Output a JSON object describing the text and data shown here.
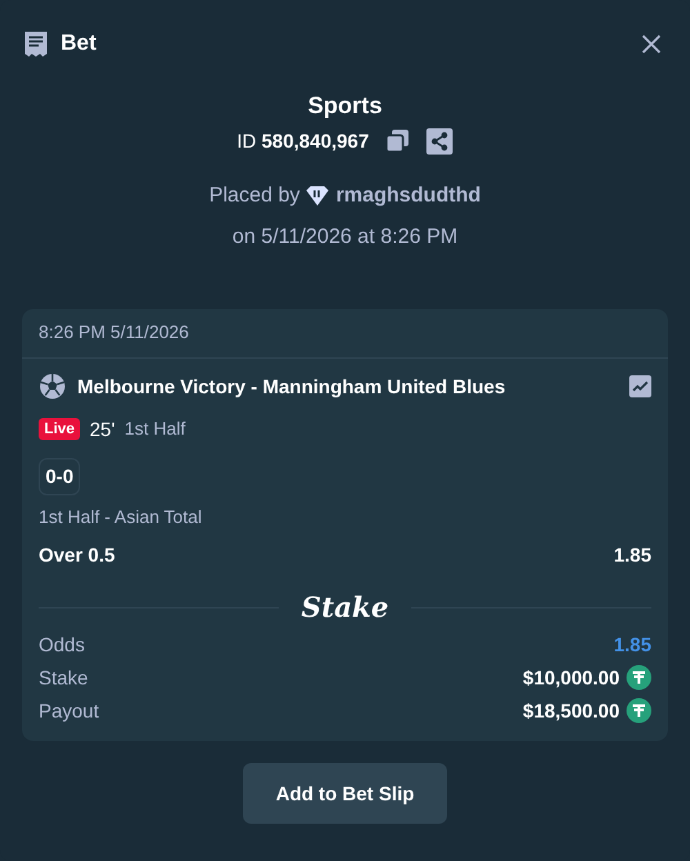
{
  "modal": {
    "title": "Bet"
  },
  "bet": {
    "category": "Sports",
    "id": "ID **580,840,967**",
    "placed_by_label": "Placed by",
    "username": "rmaghsdudthd",
    "placed_on": "on 5/11/2026 at 8:26 PM"
  },
  "card": {
    "timestamp": "8:26 PM 5/11/2026",
    "event": "Melbourne Victory - Manningham United Blues",
    "live": true,
    "live_label": "Live",
    "minute": "25'",
    "period": "1st Half",
    "score": "0-0",
    "market": "1st Half - Asian Total",
    "selection": "Over 0.5",
    "selection_odds": "1.85",
    "brand": "Stake",
    "summary": [
      {
        "label": "Odds",
        "value": "1.85",
        "kind": "odds"
      },
      {
        "label": "Stake",
        "value": "$10,000.00",
        "kind": "amount"
      },
      {
        "label": "Payout",
        "value": "$18,500.00",
        "kind": "amount"
      }
    ]
  },
  "action": "Add to Bet Slip"
}
